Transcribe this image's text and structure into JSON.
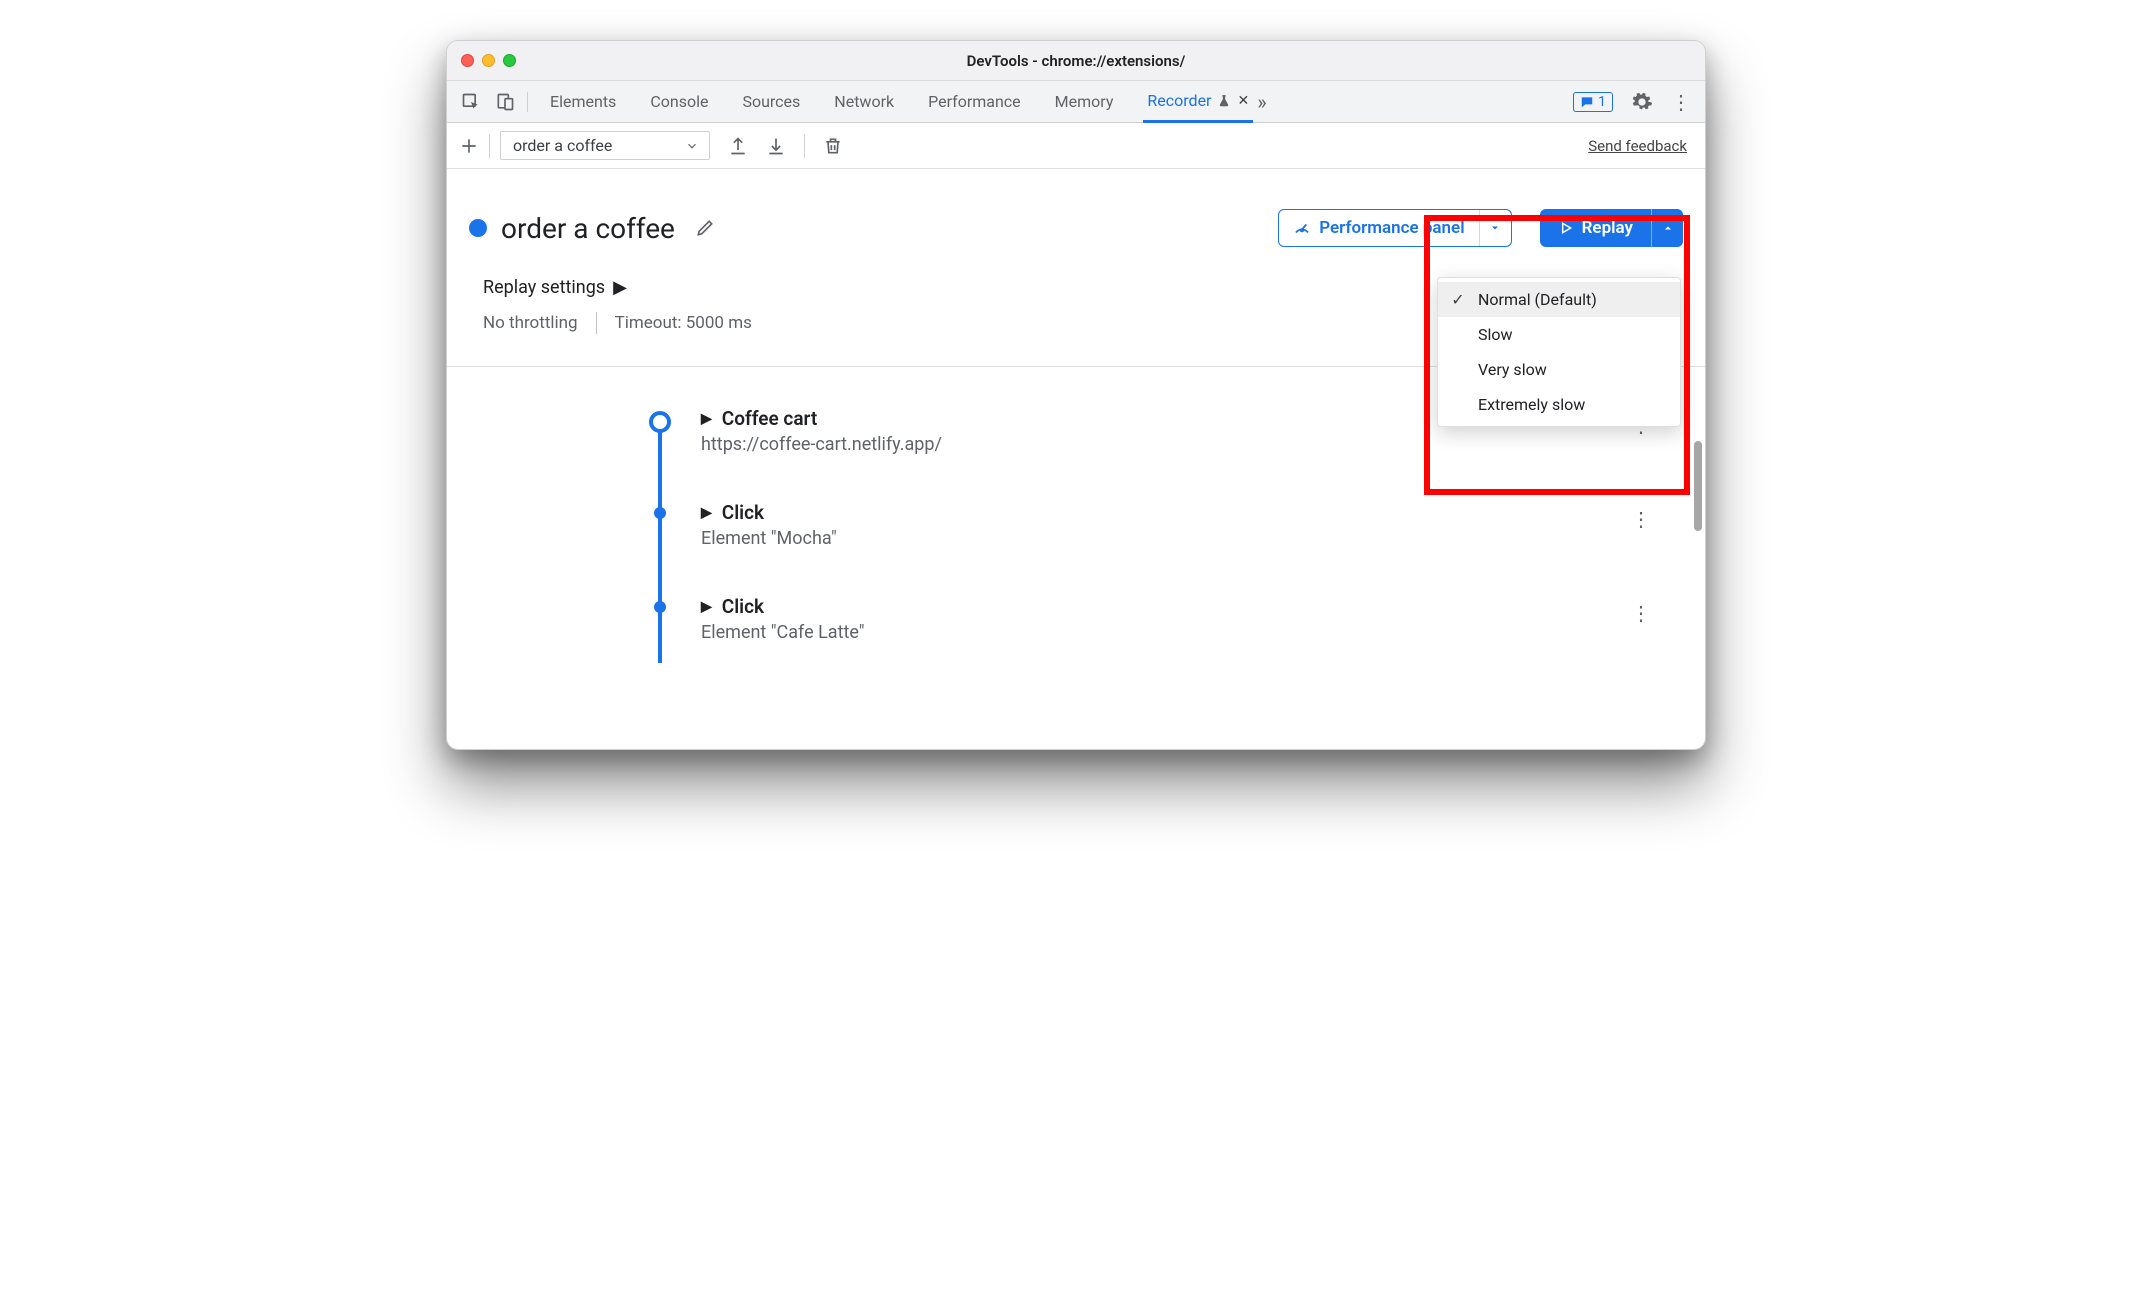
{
  "window": {
    "title": "DevTools - chrome://extensions/"
  },
  "tabs": {
    "items": [
      "Elements",
      "Console",
      "Sources",
      "Network",
      "Performance",
      "Memory",
      "Recorder"
    ],
    "active_index": 6,
    "message_count": "1"
  },
  "toolbar": {
    "recording_name": "order a coffee",
    "feedback": "Send feedback"
  },
  "header": {
    "recording_title": "order a coffee",
    "performance_button": "Performance panel",
    "replay_button": "Replay"
  },
  "settings": {
    "heading": "Replay settings",
    "throttling": "No throttling",
    "timeout": "Timeout: 5000 ms"
  },
  "steps": [
    {
      "title": "Coffee cart",
      "subtitle": "https://coffee-cart.netlify.app/",
      "start": true
    },
    {
      "title": "Click",
      "subtitle": "Element \"Mocha\"",
      "start": false
    },
    {
      "title": "Click",
      "subtitle": "Element \"Cafe Latte\"",
      "start": false
    }
  ],
  "replay_menu": {
    "items": [
      "Normal (Default)",
      "Slow",
      "Very slow",
      "Extremely slow"
    ],
    "selected_index": 0
  }
}
